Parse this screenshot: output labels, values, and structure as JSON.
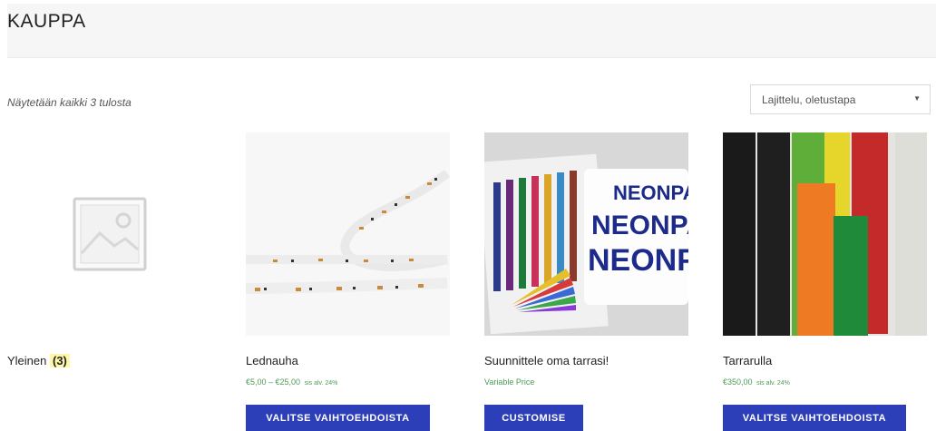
{
  "header": {
    "title": "KAUPPA"
  },
  "toolbar": {
    "result_count": "Näytetään kaikki 3 tulosta",
    "sort_selected": "Lajittelu, oletustapa",
    "sort_arrow": "▼"
  },
  "category": {
    "name": "Yleinen",
    "count": "(3)"
  },
  "products": [
    {
      "name": "Lednauha",
      "price": "€5,00 – €25,00",
      "tax": "sis alv. 24%",
      "button": "VALITSE VAIHTOEHDOISTA"
    },
    {
      "name": "Suunnittele oma tarrasi!",
      "price": "Variable Price",
      "button": "CUSTOMISE"
    },
    {
      "name": "Tarrarulla",
      "price": "€350,00",
      "tax": "sis alv. 24%",
      "button": "VALITSE VAIHTOEHDOISTA"
    }
  ],
  "image_text": {
    "neon": "NEONPA"
  },
  "colors": {
    "button": "#2c3eb8",
    "price": "#4d9a5a",
    "badge": "#fff6a8"
  },
  "icons": {
    "placeholder": "placeholder-image-icon",
    "sort": "chevron-down-icon"
  }
}
